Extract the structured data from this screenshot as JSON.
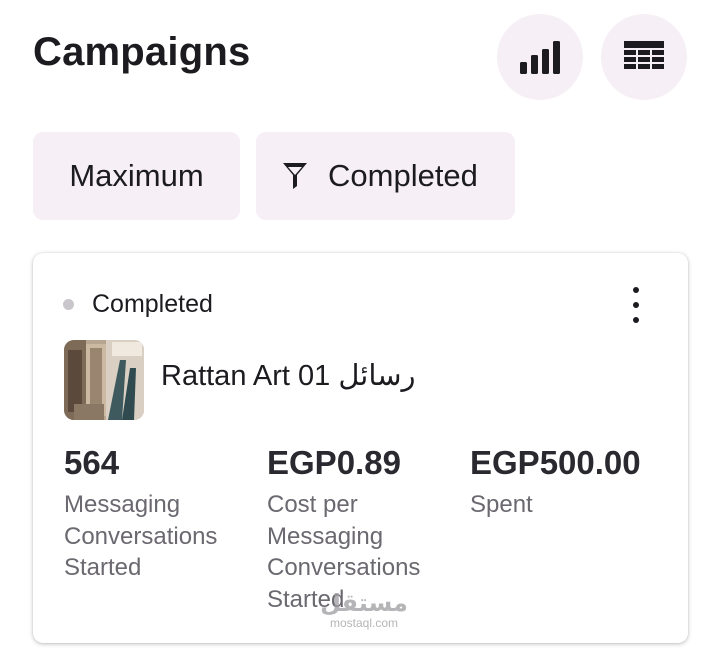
{
  "header": {
    "title": "Campaigns",
    "chart_button_icon": "bar-chart-icon",
    "table_button_icon": "table-icon"
  },
  "filters": {
    "sort_label": "Maximum",
    "status_filter_label": "Completed",
    "status_filter_icon": "filter-icon"
  },
  "campaign_card": {
    "status": "Completed",
    "status_dot_color": "#c9c6cc",
    "menu_icon": "more-vertical-icon",
    "name": "Rattan Art 01 رسائل",
    "metrics": [
      {
        "value": "564",
        "label": "Messaging Conversations Started"
      },
      {
        "value": "EGP0.89",
        "label": "Cost per Messaging Conversations Started"
      },
      {
        "value": "EGP500.00",
        "label": "Spent"
      }
    ]
  },
  "watermark": {
    "arabic": "مستقل",
    "latin": "mostaql.com"
  },
  "colors": {
    "chip_background": "#f6eff5",
    "text_primary": "#1c1b20",
    "text_secondary": "#6b6870"
  }
}
